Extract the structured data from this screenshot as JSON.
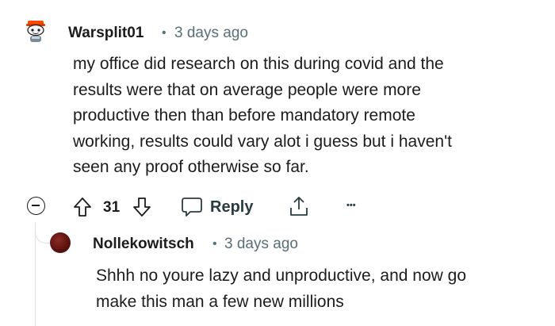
{
  "comment": {
    "author": "Warsplit01",
    "separator": "•",
    "time": "3 days ago",
    "body_lines": [
      "my office did research on this during covid and the",
      "results were that on average people were more",
      "productive then than before mandatory remote",
      "working, results could vary alot i guess but i haven't",
      "seen any proof otherwise so far."
    ],
    "actions": {
      "score": "31",
      "reply_label": "Reply",
      "more_label": "•••"
    },
    "icons": [
      "collapse-icon",
      "upvote-icon",
      "downvote-icon",
      "comment-bubble-icon",
      "share-icon",
      "more-icon"
    ]
  },
  "reply": {
    "author": "Nollekowitsch",
    "separator": "•",
    "time": "3 days ago",
    "body_lines": [
      "Shhh no youre lazy and unproductive, and now go",
      "make this man a few new millions"
    ]
  },
  "colors": {
    "text": "#1c1c1c",
    "meta": "#576f76",
    "thread_line": "#dcdfe1",
    "snoo_orange": "#ff4500"
  }
}
